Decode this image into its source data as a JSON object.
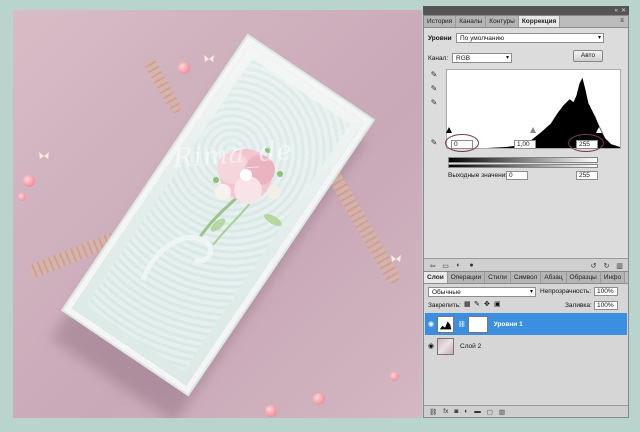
{
  "panel_tabs": {
    "tabs": [
      {
        "label": "История"
      },
      {
        "label": "Каналы"
      },
      {
        "label": "Контуры"
      },
      {
        "label": "Коррекция",
        "active": true
      }
    ]
  },
  "levels": {
    "title": "Уровни",
    "preset_value": "По умолчанию",
    "channel_label": "Канал:",
    "channel_value": "RGB",
    "auto_label": "Авто",
    "input_black": "0",
    "input_gamma": "1,00",
    "input_white": "255",
    "output_label": "Выходные значения:",
    "output_black": "0",
    "output_white": "255"
  },
  "layer_tabs": {
    "tabs": [
      {
        "label": "Слои",
        "active": true
      },
      {
        "label": "Операции"
      },
      {
        "label": "Стили"
      },
      {
        "label": "Символ"
      },
      {
        "label": "Абзац"
      },
      {
        "label": "Образцы"
      },
      {
        "label": "Инфо"
      }
    ]
  },
  "layers": {
    "blend_mode": "Обычные",
    "opacity_label": "Непрозрачность:",
    "opacity_value": "100%",
    "lock_label": "Закрепить:",
    "fill_label": "Заливка:",
    "fill_value": "100%",
    "items": [
      {
        "name": "Уровни 1",
        "selected": true
      },
      {
        "name": "Слой 2",
        "selected": false
      }
    ]
  },
  "photo": {
    "watermark": "Rima_de"
  },
  "icons": [
    "eyedropper-black-icon",
    "eyedropper-gray-icon",
    "eyedropper-white-icon",
    "eye-icon",
    "chain-icon",
    "lock-icon",
    "brush-icon",
    "move-icon",
    "link-icon",
    "fx-icon",
    "mask-icon",
    "adjustment-icon",
    "folder-icon",
    "new-layer-icon",
    "trash-icon"
  ],
  "colors": {
    "selection_blue": "#3c8fe0",
    "highlight_circle": "#7a3b56",
    "panel_bg": "#d6d6d6",
    "frame_bg": "#b9d3cd"
  }
}
